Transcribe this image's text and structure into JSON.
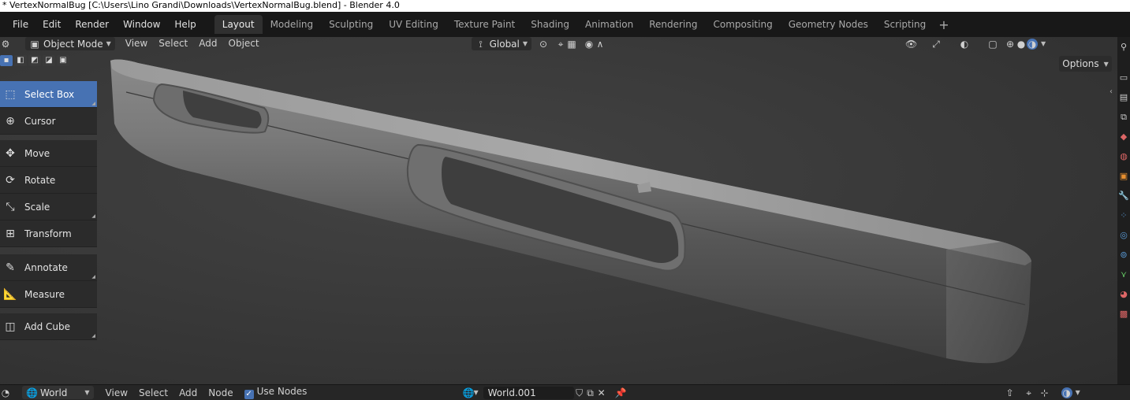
{
  "window": {
    "title": "* VertexNormalBug [C:\\Users\\Lino Grandi\\Downloads\\VertexNormalBug.blend] - Blender 4.0"
  },
  "menubar": {
    "items": [
      "File",
      "Edit",
      "Render",
      "Window",
      "Help"
    ]
  },
  "workspaces": {
    "tabs": [
      "Layout",
      "Modeling",
      "Sculpting",
      "UV Editing",
      "Texture Paint",
      "Shading",
      "Animation",
      "Rendering",
      "Compositing",
      "Geometry Nodes",
      "Scripting"
    ],
    "active": "Layout",
    "add_symbol": "+"
  },
  "viewport_header": {
    "mode": "Object Mode",
    "menus": [
      "View",
      "Select",
      "Add",
      "Object"
    ],
    "transform_orientation": "Global",
    "options_label": "Options"
  },
  "toolbar": {
    "tools": [
      {
        "label": "Select Box",
        "icon": "select-box-icon",
        "selected": true
      },
      {
        "label": "Cursor",
        "icon": "cursor-icon",
        "selected": false
      },
      {
        "label": "Move",
        "icon": "move-icon",
        "selected": false
      },
      {
        "label": "Rotate",
        "icon": "rotate-icon",
        "selected": false
      },
      {
        "label": "Scale",
        "icon": "scale-icon",
        "selected": false
      },
      {
        "label": "Transform",
        "icon": "transform-icon",
        "selected": false
      },
      {
        "label": "Annotate",
        "icon": "annotate-icon",
        "selected": false
      },
      {
        "label": "Measure",
        "icon": "measure-icon",
        "selected": false
      },
      {
        "label": "Add Cube",
        "icon": "add-cube-icon",
        "selected": false
      }
    ]
  },
  "bottom_header": {
    "world_dropdown": "World",
    "menus": [
      "View",
      "Select",
      "Add",
      "Node"
    ],
    "use_nodes_label": "Use Nodes",
    "use_nodes_checked": true,
    "world_name": "World.001"
  },
  "colors": {
    "accent": "#4772b3",
    "background": "#1d1d1d",
    "viewport": "#3a3a3a"
  }
}
